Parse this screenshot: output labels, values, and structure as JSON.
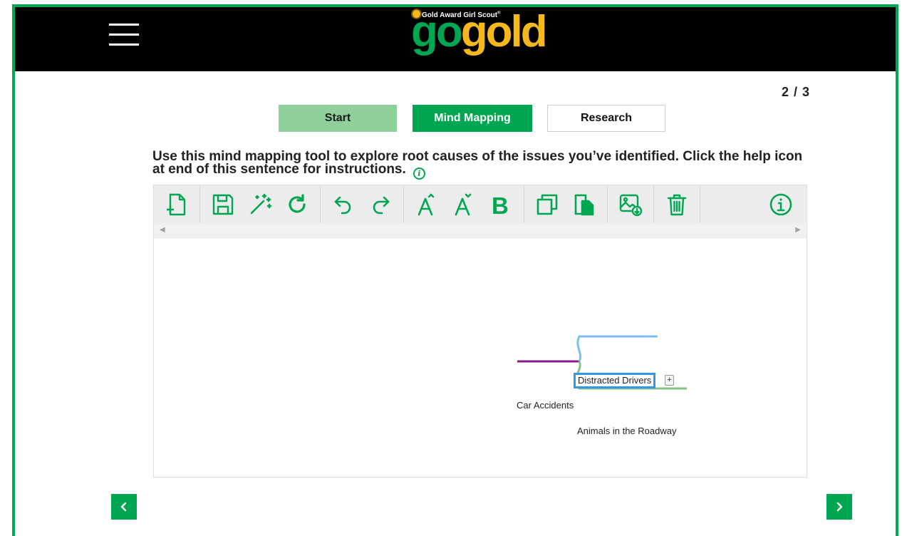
{
  "brand": {
    "tagline": "Gold Award Girl Scout",
    "tagline_mark": "®",
    "logo_part1": "go",
    "logo_part2": "gold"
  },
  "progress": {
    "counter": "2 / 3"
  },
  "tabs": [
    {
      "label": "Start",
      "state": "completed"
    },
    {
      "label": "Mind Mapping",
      "state": "active"
    },
    {
      "label": "Research",
      "state": "inactive"
    }
  ],
  "instructions": "Use this mind mapping tool to explore root causes of the issues you’ve identified. Click the help icon at end of this sentence for instructions.",
  "toolbar": {
    "icons": [
      "new-document-icon",
      "save-icon",
      "magic-wand-icon",
      "refresh-icon",
      "undo-icon",
      "redo-icon",
      "increase-font-icon",
      "decrease-font-icon",
      "bold-icon",
      "copy-icon",
      "paste-icon",
      "export-image-icon",
      "trash-icon",
      "info-icon"
    ],
    "icon_color": "#00a651"
  },
  "mindmap": {
    "root": "Car Accidents",
    "children": [
      "Distracted Drivers",
      "Animals in the Roadway"
    ],
    "selected": "Distracted Drivers",
    "add_child_label": "+",
    "colors": {
      "root": "#8b1a8b",
      "child1": "#7cc0ea",
      "child2": "#88c08a",
      "selection": "#3597e8"
    }
  },
  "navigation": {
    "prev_icon": "chevron-left-icon",
    "next_icon": "chevron-right-icon"
  },
  "colors": {
    "brand_green": "#00a651",
    "brand_gold": "#f5b81c",
    "tab_done": "#8fcf9a",
    "header_bg": "#000000"
  }
}
